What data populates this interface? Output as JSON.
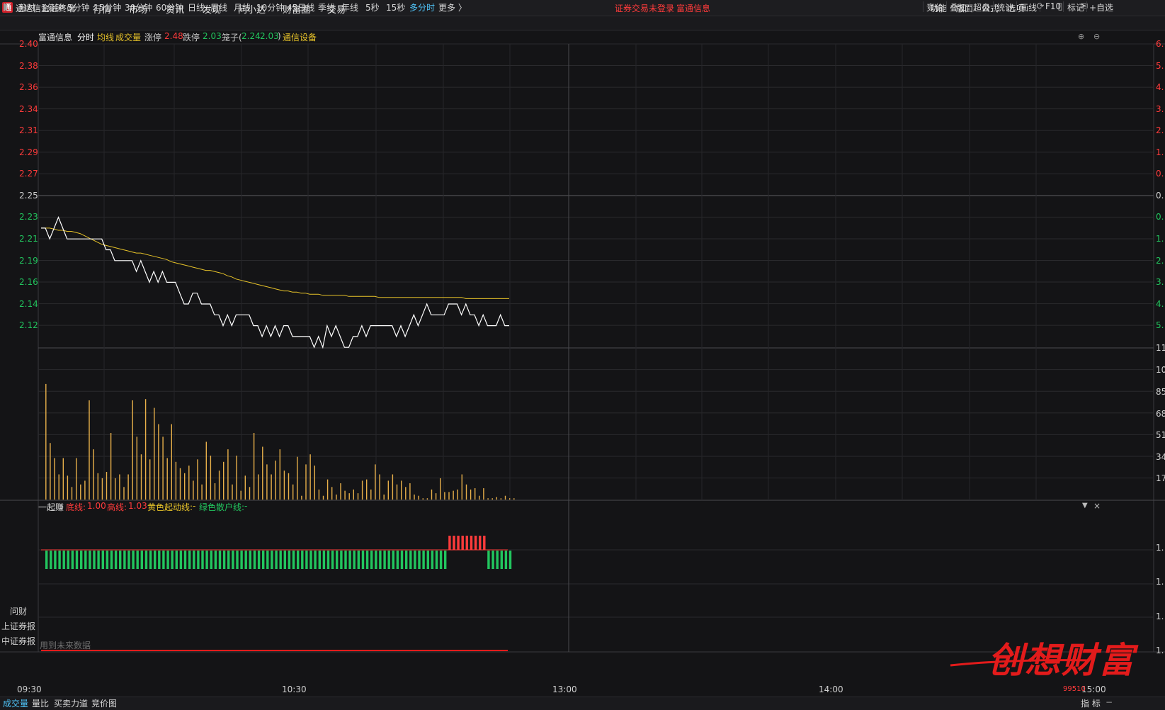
{
  "app": {
    "title": "通达信金融终端",
    "logo_glyph": "通"
  },
  "menu": [
    "行情",
    "市场",
    "资讯",
    "发现",
    "问小达",
    "财富圈",
    "交易"
  ],
  "notices": {
    "login": "证券交易未登录",
    "stock_name": "富通信息"
  },
  "right_menu": [
    "功能",
    "版面",
    "公式",
    "选项"
  ],
  "periods": [
    "分时",
    "1分钟",
    "5分钟",
    "15分钟",
    "30分钟",
    "60分钟",
    "日线",
    "周线",
    "月线",
    "10分钟",
    "45日线",
    "季线",
    "年线",
    "5秒",
    "15秒",
    "多分时",
    "更多 〉"
  ],
  "active_period": "多分时",
  "tools": [
    "竞价",
    "叠加",
    "超盘",
    "统计",
    "画线",
    "F10",
    "标记",
    "+自选"
  ],
  "info": {
    "name": "富通信息",
    "mode": "分时",
    "avg": "均线",
    "vol": "成交量",
    "up_label": "涨停",
    "up_value": "2.48",
    "down_label": "跌停",
    "down_value": "2.03",
    "cage_label": "笼子(",
    "cage_hi": "2.24",
    "cage_lo": "2.03",
    "cage_close": ")",
    "industry": "通信设备"
  },
  "price_axis_left": [
    "2.40",
    "2.38",
    "2.36",
    "2.34",
    "2.31",
    "2.29",
    "2.27",
    "2.25",
    "2.23",
    "2.21",
    "2.19",
    "2.16",
    "2.14",
    "2.12"
  ],
  "price_axis_right": [
    "6.",
    "5.",
    "4.",
    "3.",
    "2.",
    "1.",
    "0.",
    "0.",
    "0.",
    "1.",
    "2.",
    "3.",
    "4.",
    "5."
  ],
  "volume_axis_right": [
    "11",
    "10",
    "85",
    "68",
    "51",
    "34",
    "17"
  ],
  "indicator": {
    "name": "一起赚",
    "bottom_label": "底线:",
    "bottom_value": "1.00",
    "top_label": "高线:",
    "top_value": "1.03",
    "yellow_label": "黄色起动线:",
    "yellow_value": "-",
    "green_label": "绿色散户线:",
    "green_value": "-",
    "axis_right": [
      "1.",
      "1.",
      "1.",
      "1."
    ],
    "future_note": "用到未来数据"
  },
  "side_buttons": [
    "问财",
    "上证券报",
    "中证券报"
  ],
  "time_axis": [
    "09:30",
    "10:30",
    "13:00",
    "14:00",
    "15:00"
  ],
  "bottom_tabs": [
    "成交量",
    "量比",
    "买卖力道",
    "竞价图"
  ],
  "bottom_right": {
    "label": "指 标",
    "code": "99510"
  },
  "watermark": "创想财富",
  "colors": {
    "bg": "#141416",
    "up": "#ff3b3b",
    "down": "#22c55e",
    "avg": "#e6c229",
    "vol": "#e8b04a",
    "price": "#ffffff",
    "accent": "#4fc3f7"
  },
  "chart_data": {
    "type": "line",
    "price_series": [
      2.22,
      2.22,
      2.21,
      2.22,
      2.23,
      2.22,
      2.21,
      2.21,
      2.21,
      2.21,
      2.21,
      2.21,
      2.21,
      2.21,
      2.21,
      2.2,
      2.2,
      2.19,
      2.19,
      2.19,
      2.19,
      2.19,
      2.18,
      2.19,
      2.18,
      2.17,
      2.18,
      2.17,
      2.18,
      2.17,
      2.17,
      2.17,
      2.16,
      2.15,
      2.15,
      2.16,
      2.16,
      2.15,
      2.15,
      2.15,
      2.14,
      2.14,
      2.13,
      2.14,
      2.13,
      2.14,
      2.14,
      2.14,
      2.14,
      2.13,
      2.13,
      2.12,
      2.13,
      2.12,
      2.13,
      2.12,
      2.13,
      2.13,
      2.12,
      2.12,
      2.12,
      2.12,
      2.12,
      2.11,
      2.12,
      2.11,
      2.13,
      2.12,
      2.13,
      2.12,
      2.11,
      2.11,
      2.12,
      2.12,
      2.13,
      2.12,
      2.13,
      2.13,
      2.13,
      2.13,
      2.13,
      2.13,
      2.12,
      2.13,
      2.12,
      2.13,
      2.14,
      2.13,
      2.14,
      2.15,
      2.14,
      2.14,
      2.14,
      2.14,
      2.15,
      2.15,
      2.15,
      2.14,
      2.15,
      2.14,
      2.14,
      2.13,
      2.14,
      2.13,
      2.13,
      2.13,
      2.14,
      2.13,
      2.13
    ],
    "avg_series": [
      2.22,
      2.22,
      2.22,
      2.219,
      2.218,
      2.218,
      2.217,
      2.217,
      2.216,
      2.215,
      2.213,
      2.211,
      2.209,
      2.207,
      2.205,
      2.204,
      2.203,
      2.202,
      2.201,
      2.2,
      2.199,
      2.198,
      2.197,
      2.197,
      2.196,
      2.195,
      2.194,
      2.193,
      2.192,
      2.191,
      2.189,
      2.188,
      2.187,
      2.186,
      2.185,
      2.184,
      2.183,
      2.182,
      2.181,
      2.181,
      2.18,
      2.179,
      2.178,
      2.176,
      2.175,
      2.173,
      2.172,
      2.171,
      2.17,
      2.169,
      2.168,
      2.167,
      2.166,
      2.165,
      2.164,
      2.163,
      2.162,
      2.162,
      2.161,
      2.161,
      2.16,
      2.16,
      2.159,
      2.159,
      2.159,
      2.158,
      2.158,
      2.158,
      2.158,
      2.158,
      2.158,
      2.157,
      2.157,
      2.157,
      2.157,
      2.157,
      2.157,
      2.157,
      2.156,
      2.156,
      2.156,
      2.156,
      2.156,
      2.156,
      2.156,
      2.156,
      2.156,
      2.156,
      2.156,
      2.156,
      2.156,
      2.156,
      2.156,
      2.156,
      2.156,
      2.156,
      2.156,
      2.156,
      2.155,
      2.155,
      2.155,
      2.155,
      2.155,
      2.155,
      2.155,
      2.155,
      2.155,
      2.155,
      2.155
    ],
    "volume": [
      0,
      92,
      45,
      33,
      20,
      33,
      19,
      10,
      33,
      12,
      15,
      79,
      40,
      21,
      17,
      22,
      53,
      17,
      20,
      10,
      20,
      79,
      50,
      36,
      80,
      32,
      73,
      60,
      50,
      33,
      60,
      30,
      25,
      21,
      27,
      15,
      32,
      12,
      46,
      35,
      13,
      23,
      30,
      40,
      12,
      35,
      7,
      19,
      10,
      53,
      20,
      42,
      28,
      20,
      31,
      40,
      23,
      21,
      12,
      34,
      3,
      28,
      36,
      27,
      8,
      3,
      16,
      10,
      4,
      13,
      7,
      5,
      8,
      5,
      15,
      16,
      8,
      28,
      20,
      4,
      15,
      20,
      12,
      15,
      10,
      13,
      4,
      3,
      1,
      1,
      8,
      5,
      17,
      6,
      6,
      7,
      8,
      20,
      12,
      8,
      9,
      3,
      9,
      1,
      1,
      2,
      1,
      3,
      1,
      1
    ],
    "volume_peak": 110,
    "indicator_red_from": 94,
    "indicator_red_to": 102
  }
}
